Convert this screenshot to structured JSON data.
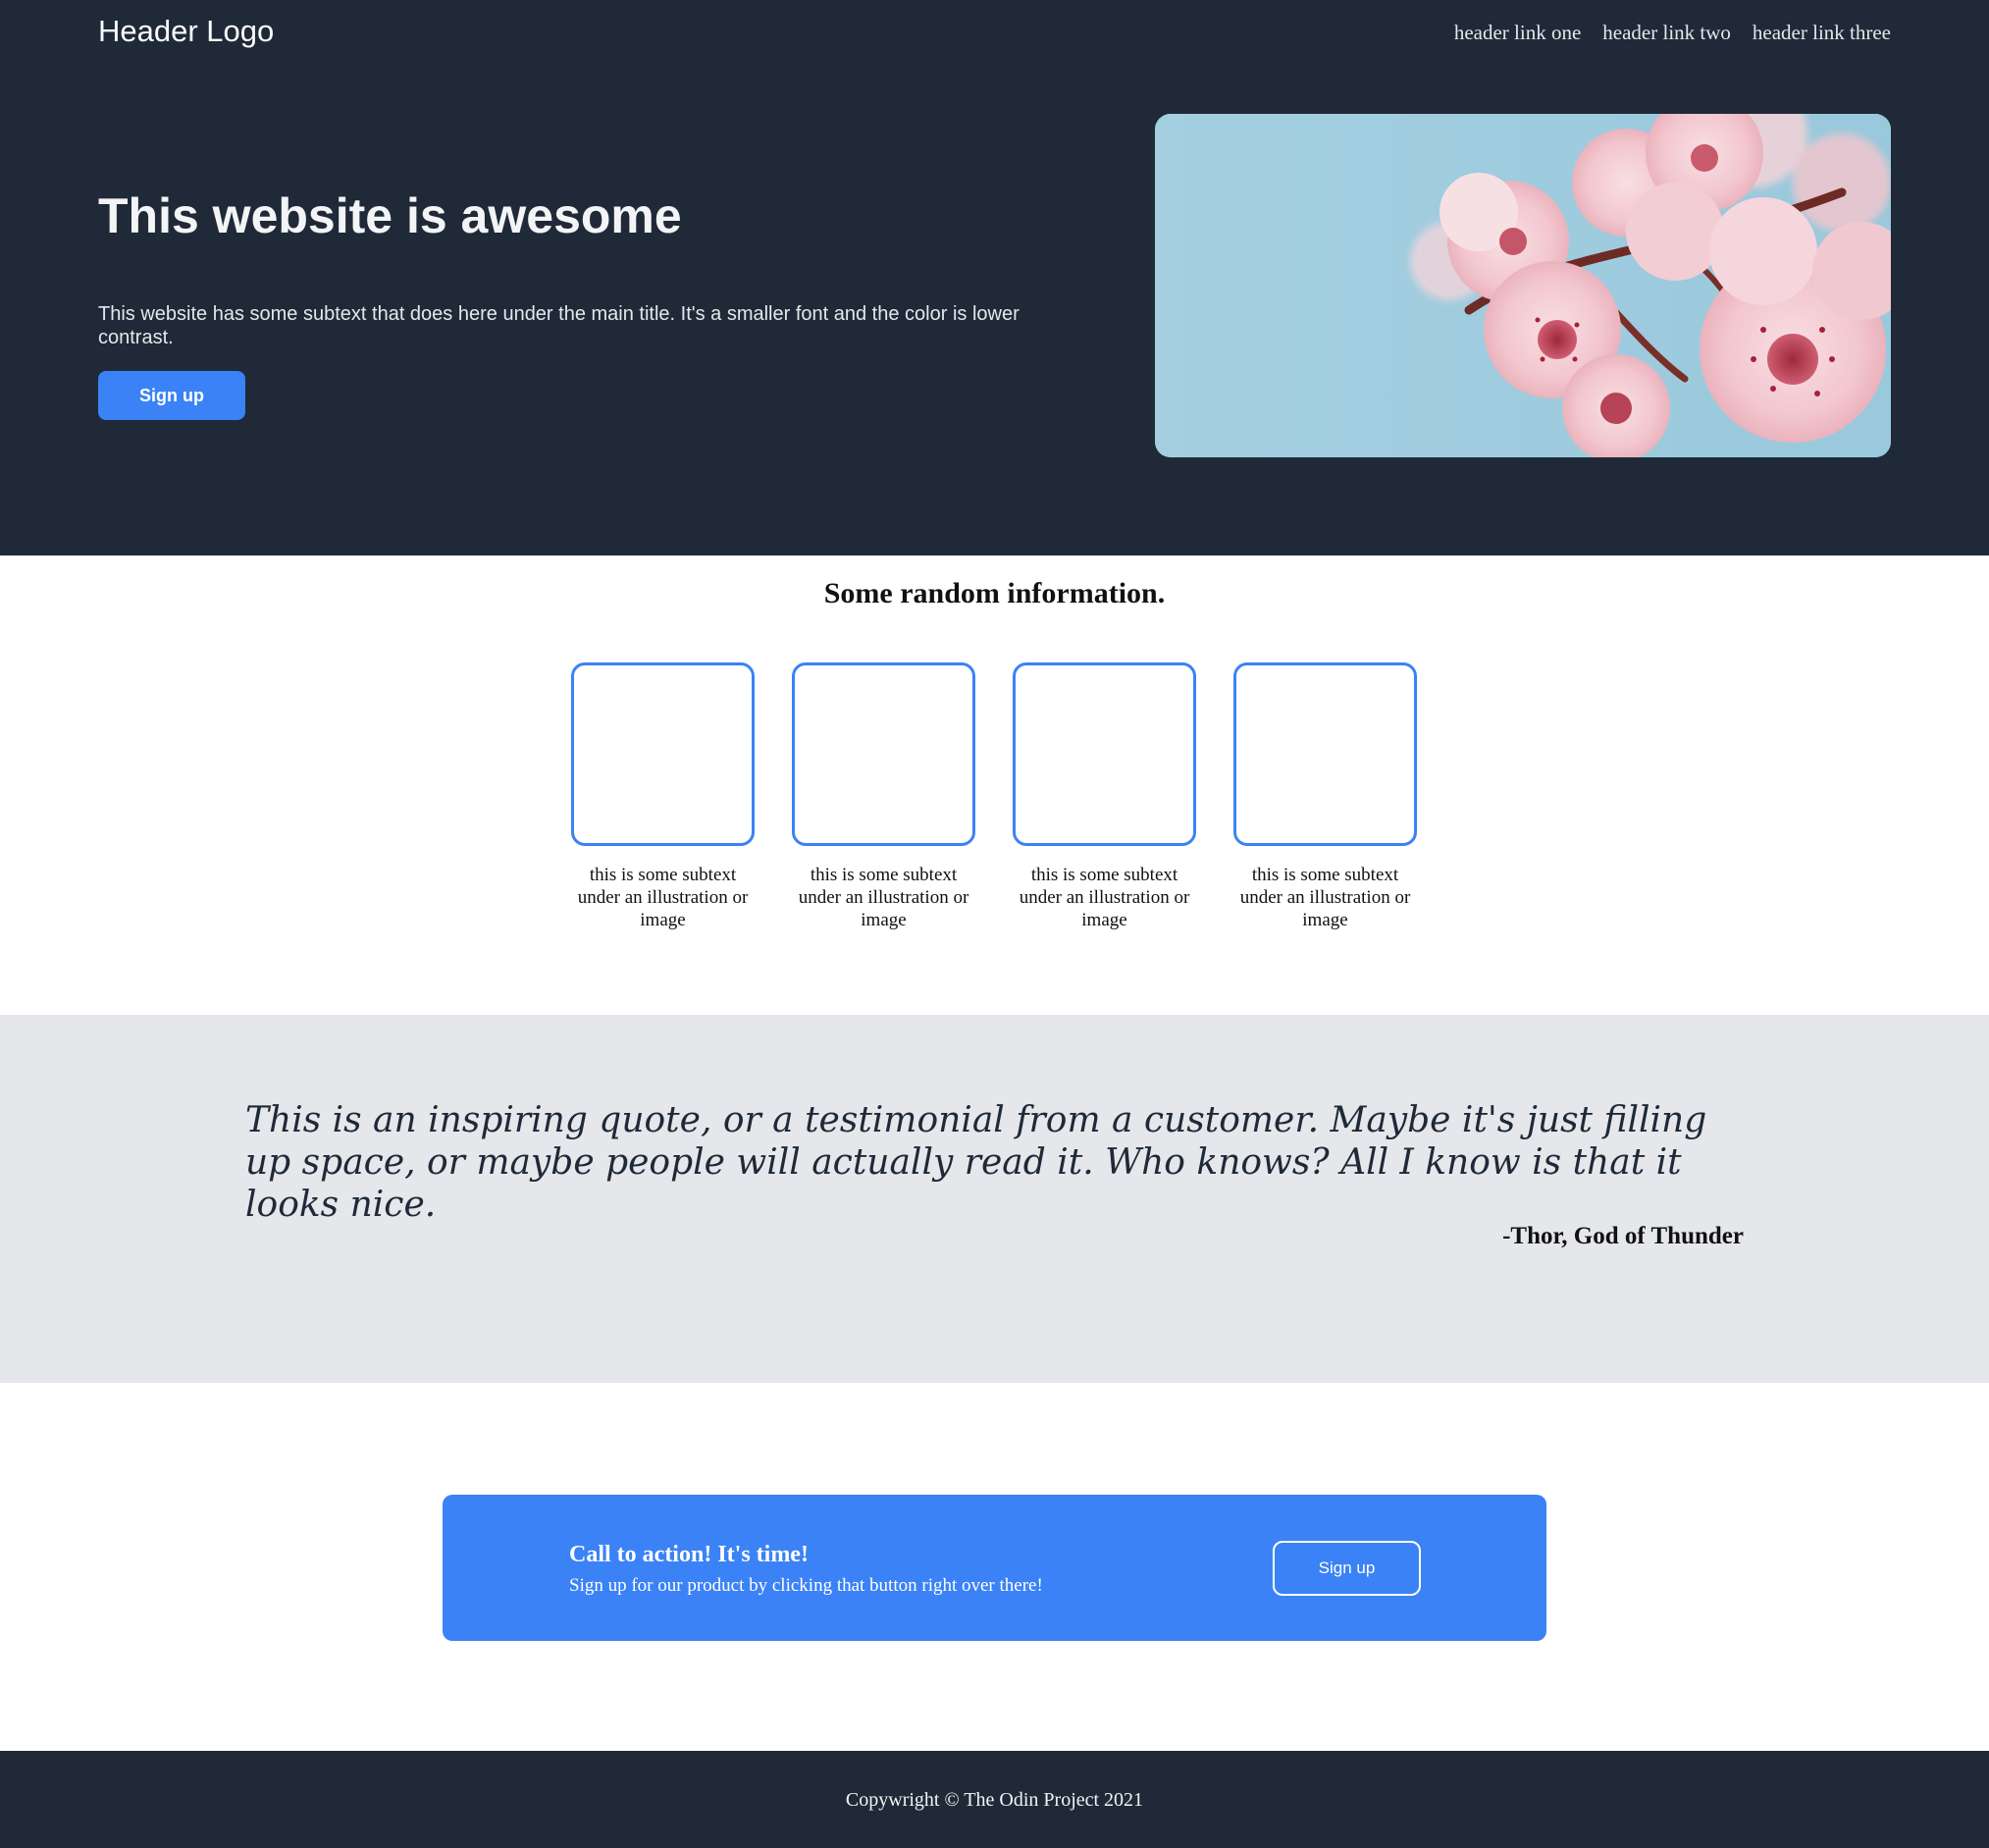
{
  "header": {
    "logo": "Header Logo",
    "links": [
      "header link one",
      "header link two",
      "header link three"
    ]
  },
  "hero": {
    "title": "This website is awesome",
    "subtext": "This website has some subtext that does here under the main title. It's a smaller font and the color is lower contrast.",
    "button_label": "Sign up",
    "image_icon": "cherry-blossom-photo"
  },
  "info": {
    "heading": "Some random information.",
    "cards": [
      {
        "text": "this is some subtext under an illustration or image"
      },
      {
        "text": "this is some subtext under an illustration or image"
      },
      {
        "text": "this is some subtext under an illustration or image"
      },
      {
        "text": "this is some subtext under an illustration or image"
      }
    ]
  },
  "quote": {
    "text": "This is an inspiring quote, or a testimonial from a customer. Maybe it's just filling up space, or maybe people will actually read it. Who knows? All I know is that it looks nice.",
    "author": "-Thor, God of Thunder"
  },
  "cta": {
    "title": "Call to action! It's time!",
    "subtext": "Sign up for our product by clicking that button right over there!",
    "button_label": "Sign up"
  },
  "footer": {
    "text": "Copywright © The Odin Project 2021"
  },
  "colors": {
    "dark_bg": "#1f2937",
    "accent": "#3b82f6",
    "quote_bg": "#e5e7eb"
  }
}
